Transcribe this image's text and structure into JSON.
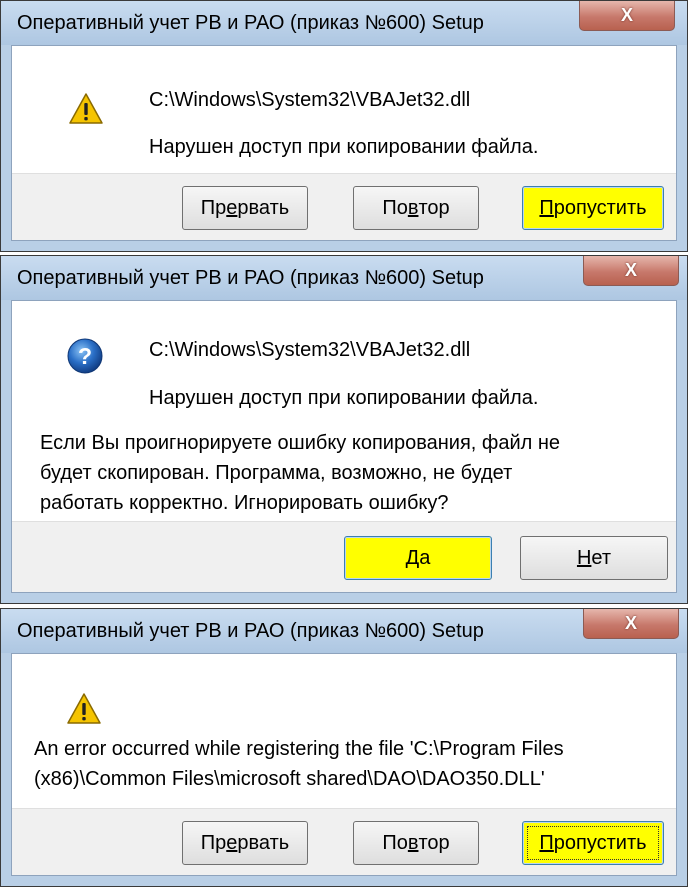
{
  "dialog1": {
    "title": "Оперативный учет РВ и РАО (приказ №600) Setup",
    "close_label": "X",
    "path": "C:\\Windows\\System32\\VBAJet32.dll",
    "message": "Нарушен доступ при копировании файла.",
    "buttons": {
      "abort": {
        "pre": "Пр",
        "accel": "е",
        "post": "рвать"
      },
      "retry": {
        "pre": "По",
        "accel": "в",
        "post": "тор"
      },
      "skip": {
        "pre": "",
        "accel": "П",
        "post": "ропустить"
      }
    }
  },
  "dialog2": {
    "title": "Оперативный учет РВ и РАО (приказ №600) Setup",
    "close_label": "X",
    "path": "C:\\Windows\\System32\\VBAJet32.dll",
    "message": "Нарушен доступ при копировании файла.",
    "question_lines": [
      "Если Вы проигнорируете ошибку копирования, файл не",
      "будет скопирован.  Программа, возможно, не будет",
      "работать корректно.  Игнорировать ошибку?"
    ],
    "buttons": {
      "yes": {
        "pre": "",
        "accel": "Д",
        "post": "а"
      },
      "no": {
        "pre": "",
        "accel": "Н",
        "post": "ет"
      }
    }
  },
  "dialog3": {
    "title": "Оперативный учет РВ и РАО (приказ №600) Setup",
    "close_label": "X",
    "message_lines": [
      "An error occurred while registering the file 'C:\\Program Files",
      "(x86)\\Common Files\\microsoft shared\\DAO\\DAO350.DLL'"
    ],
    "buttons": {
      "abort": {
        "pre": "Пр",
        "accel": "е",
        "post": "рвать"
      },
      "retry": {
        "pre": "По",
        "accel": "в",
        "post": "тор"
      },
      "skip": {
        "pre": "",
        "accel": "П",
        "post": "ропустить"
      }
    }
  },
  "colors": {
    "frame": "#b9cfe6",
    "primary_button": "#ffff00",
    "close_button": "#c7786b"
  },
  "icons": {
    "warning": "warning-icon",
    "question": "question-icon",
    "close": "close-icon"
  }
}
